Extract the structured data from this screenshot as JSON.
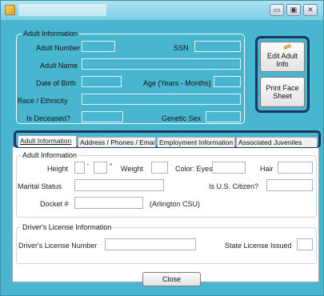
{
  "window": {
    "title": ""
  },
  "adult_info": {
    "legend": "Adult Information",
    "adult_number_label": "Adult Number",
    "ssn_label": "SSN",
    "adult_name_label": "Adult Name",
    "dob_label": "Date of Birth",
    "age_label": "Age (Years - Months)",
    "race_label": "Race / Ethnicity",
    "deceased_label": "Is Deceased?",
    "genetic_sex_label": "Genetic Sex"
  },
  "side_buttons": {
    "edit_label": "Edit Adult Info",
    "print_label": "Print Face Sheet"
  },
  "tabs": [
    {
      "label": "Adult Information"
    },
    {
      "label": "Address / Phones / Email"
    },
    {
      "label": "Employment Information"
    },
    {
      "label": "Associated Juveniles"
    }
  ],
  "tab_adult": {
    "legend": "Adult Information",
    "height_label": "Height",
    "feet_mark": "'",
    "inch_mark": "\"",
    "weight_label": "Weight",
    "color_eyes_label": "Color: Eyes",
    "hair_label": "Hair",
    "marital_label": "Marital Status",
    "citizen_label": "Is U.S. Citizen?",
    "docket_label": "Docket #",
    "docket_note": "(Arlington CSU)"
  },
  "drivers_license": {
    "legend": "Driver's License Information",
    "number_label": "Driver's License Number",
    "state_label": "State License Issued"
  },
  "footer": {
    "close_label": "Close"
  }
}
